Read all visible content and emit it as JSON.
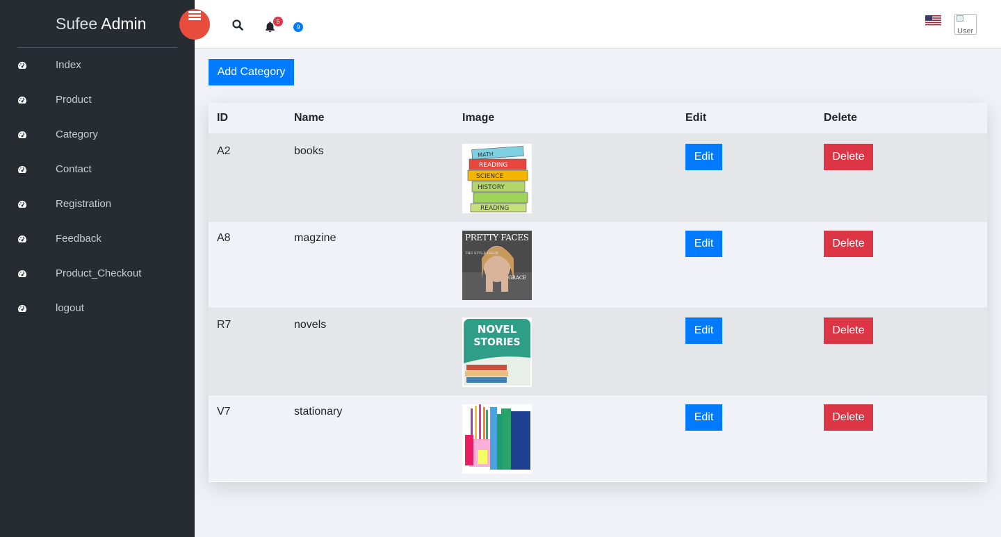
{
  "brand": {
    "part1": "Sufee",
    "part2": "Admin"
  },
  "sidebar": {
    "items": [
      {
        "label": "Index",
        "icon": "dashboard-icon"
      },
      {
        "label": "Product",
        "icon": "dashboard-icon"
      },
      {
        "label": "Category",
        "icon": "dashboard-icon"
      },
      {
        "label": "Contact",
        "icon": "dashboard-icon"
      },
      {
        "label": "Registration",
        "icon": "dashboard-icon"
      },
      {
        "label": "Feedback",
        "icon": "dashboard-icon"
      },
      {
        "label": "Product_Checkout",
        "icon": "dashboard-icon"
      },
      {
        "label": "logout",
        "icon": "dashboard-icon"
      }
    ]
  },
  "header": {
    "notification_count": "5",
    "message_count": "9",
    "language_flag": "us-flag",
    "avatar_alt": "User"
  },
  "toolbar": {
    "add_label": "Add Category"
  },
  "table": {
    "columns": [
      "ID",
      "Name",
      "Image",
      "Edit",
      "Delete"
    ],
    "rows": [
      {
        "id": "A2",
        "name": "books",
        "image": "books-stack-thumbnail",
        "edit": "Edit",
        "delete": "Delete"
      },
      {
        "id": "A8",
        "name": "magzine",
        "image": "magazine-cover-thumbnail",
        "edit": "Edit",
        "delete": "Delete"
      },
      {
        "id": "R7",
        "name": "novels",
        "image": "novel-stories-thumbnail",
        "edit": "Edit",
        "delete": "Delete"
      },
      {
        "id": "V7",
        "name": "stationary",
        "image": "stationery-thumbnail",
        "edit": "Edit",
        "delete": "Delete"
      }
    ],
    "thumbnail_text": {
      "books": [
        "MATH",
        "READING",
        "SCIENCE",
        "HISTORY",
        "READING"
      ],
      "magazine": [
        "PRETTY FACES",
        "THE STYLE ISSUE",
        "GRACE"
      ],
      "novels": [
        "NOVEL",
        "STORIES"
      ]
    }
  },
  "colors": {
    "sidebar_bg": "#272c33",
    "primary": "#007bff",
    "danger": "#dc3545",
    "toggle": "#e74c3c"
  }
}
